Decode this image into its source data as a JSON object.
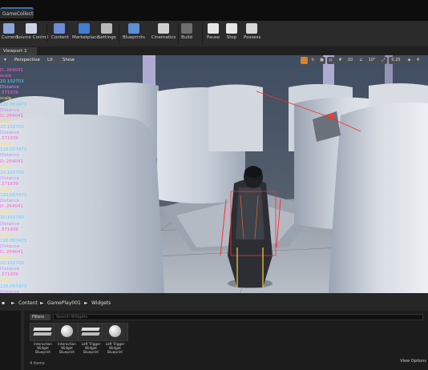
{
  "title_tab": "GameCollector",
  "toolbar": {
    "buttons": [
      {
        "label": "Current",
        "color": "#8aa7d8"
      },
      {
        "label": "Source Control",
        "color": "#c9d4e6"
      },
      {
        "label": "Content",
        "color": "#6b8cd8"
      },
      {
        "label": "Marketplace",
        "color": "#3e7fd1"
      },
      {
        "label": "Settings",
        "color": "#b8b8b8"
      },
      {
        "label": "Blueprints",
        "color": "#5b8fd6"
      },
      {
        "label": "Cinematics",
        "color": "#cfcfcf"
      },
      {
        "label": "Build",
        "color": "#6f6f6f"
      },
      {
        "label": "Pause",
        "color": "#e6e6e6"
      },
      {
        "label": "Stop",
        "color": "#e6e6e6"
      },
      {
        "label": "Possess",
        "color": "#d8d8d8"
      }
    ]
  },
  "viewport": {
    "tab_label": "Viewport 1",
    "perspective": "Perspective",
    "lit": "Lit",
    "show": "Show",
    "right_controls": [
      "10",
      "10°",
      "0.25",
      "4"
    ]
  },
  "stats": [
    {
      "text": "D:.264041",
      "color": "pink"
    },
    {
      "text": "scale",
      "color": "pink"
    },
    {
      "text": "20.102703",
      "color": "blue"
    },
    {
      "text": "Distance",
      "color": "purple"
    },
    {
      "text": ".371939",
      "color": "pink"
    },
    {
      "text": "scale",
      "color": "yellow"
    },
    {
      "text": "120.057473",
      "color": "blue"
    },
    {
      "text": "Distance",
      "color": "purple"
    },
    {
      "text": "D:.264041",
      "color": "pink"
    },
    {
      "text": "scale",
      "color": "yellow"
    },
    {
      "text": "20.102703",
      "color": "blue"
    },
    {
      "text": "Distance",
      "color": "purple"
    },
    {
      "text": ".371939",
      "color": "pink"
    },
    {
      "text": "scale",
      "color": "yellow"
    },
    {
      "text": "120.057473",
      "color": "blue"
    },
    {
      "text": "Distance",
      "color": "purple"
    },
    {
      "text": "D:.264041",
      "color": "pink"
    },
    {
      "text": "scale",
      "color": "yellow"
    },
    {
      "text": "20.102703",
      "color": "blue"
    },
    {
      "text": "Distance",
      "color": "purple"
    },
    {
      "text": ".371939",
      "color": "pink"
    },
    {
      "text": "scale",
      "color": "yellow"
    },
    {
      "text": "120.057473",
      "color": "blue"
    },
    {
      "text": "Distance",
      "color": "purple"
    },
    {
      "text": "D:.264041",
      "color": "pink"
    },
    {
      "text": "scale",
      "color": "yellow"
    },
    {
      "text": "20.102703",
      "color": "blue"
    },
    {
      "text": "Distance",
      "color": "purple"
    },
    {
      "text": ".371939",
      "color": "pink"
    },
    {
      "text": "scale",
      "color": "yellow"
    },
    {
      "text": "120.057473",
      "color": "blue"
    },
    {
      "text": "Distance",
      "color": "purple"
    },
    {
      "text": "D:.264041",
      "color": "pink"
    },
    {
      "text": "scale",
      "color": "yellow"
    },
    {
      "text": "20.102703",
      "color": "blue"
    },
    {
      "text": "Distance",
      "color": "purple"
    },
    {
      "text": ".371939",
      "color": "pink"
    },
    {
      "text": "scale",
      "color": "yellow"
    },
    {
      "text": "120.057473",
      "color": "blue"
    },
    {
      "text": "Distance",
      "color": "purple"
    }
  ],
  "content_browser": {
    "path": [
      "Content",
      "GamePlay001",
      "Widgets"
    ],
    "filters": "Filters",
    "search_placeholder": "Search Widgets",
    "assets": [
      {
        "label": "Interaction Widget Blueprint",
        "kind": "widget"
      },
      {
        "label": "Interaction Widget Blueprint",
        "kind": "sphere"
      },
      {
        "label": "Left Trigger Widget Blueprint",
        "kind": "widget"
      },
      {
        "label": "Left Trigger Widget Blueprint",
        "kind": "sphere"
      }
    ],
    "items_count": "4 items",
    "view_options": "View Options"
  }
}
